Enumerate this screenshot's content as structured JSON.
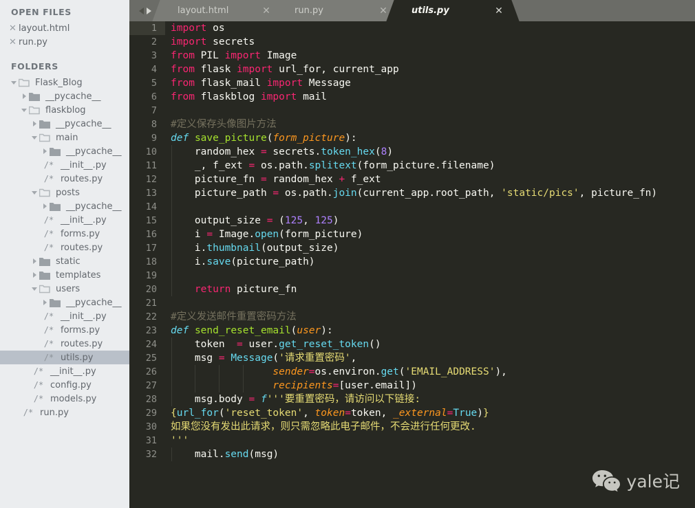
{
  "sidebar": {
    "open_files_header": "OPEN FILES",
    "open_files": [
      {
        "close_icon": "close-icon",
        "name": "layout.html"
      },
      {
        "close_icon": "close-icon",
        "name": "run.py"
      }
    ],
    "folders_header": "FOLDERS",
    "tree": [
      {
        "depth": 0,
        "type": "folder",
        "state": "open",
        "name": "Flask_Blog",
        "selected": false
      },
      {
        "depth": 1,
        "type": "folder",
        "state": "closed",
        "name": "__pycache__",
        "selected": false
      },
      {
        "depth": 1,
        "type": "folder",
        "state": "open",
        "name": "flaskblog",
        "selected": false
      },
      {
        "depth": 2,
        "type": "folder",
        "state": "closed",
        "name": "__pycache__",
        "selected": false
      },
      {
        "depth": 2,
        "type": "folder",
        "state": "open",
        "name": "main",
        "selected": false
      },
      {
        "depth": 3,
        "type": "folder",
        "state": "closed",
        "name": "__pycache__",
        "selected": false
      },
      {
        "depth": 3,
        "type": "file",
        "marker": "/*",
        "name": "__init__.py",
        "selected": false
      },
      {
        "depth": 3,
        "type": "file",
        "marker": "/*",
        "name": "routes.py",
        "selected": false
      },
      {
        "depth": 2,
        "type": "folder",
        "state": "open",
        "name": "posts",
        "selected": false
      },
      {
        "depth": 3,
        "type": "folder",
        "state": "closed",
        "name": "__pycache__",
        "selected": false
      },
      {
        "depth": 3,
        "type": "file",
        "marker": "/*",
        "name": "__init__.py",
        "selected": false
      },
      {
        "depth": 3,
        "type": "file",
        "marker": "/*",
        "name": "forms.py",
        "selected": false
      },
      {
        "depth": 3,
        "type": "file",
        "marker": "/*",
        "name": "routes.py",
        "selected": false
      },
      {
        "depth": 2,
        "type": "folder",
        "state": "closed",
        "name": "static",
        "selected": false
      },
      {
        "depth": 2,
        "type": "folder",
        "state": "closed",
        "name": "templates",
        "selected": false
      },
      {
        "depth": 2,
        "type": "folder",
        "state": "open",
        "name": "users",
        "selected": false
      },
      {
        "depth": 3,
        "type": "folder",
        "state": "closed",
        "name": "__pycache__",
        "selected": false
      },
      {
        "depth": 3,
        "type": "file",
        "marker": "/*",
        "name": "__init__.py",
        "selected": false
      },
      {
        "depth": 3,
        "type": "file",
        "marker": "/*",
        "name": "forms.py",
        "selected": false
      },
      {
        "depth": 3,
        "type": "file",
        "marker": "/*",
        "name": "routes.py",
        "selected": false
      },
      {
        "depth": 3,
        "type": "file",
        "marker": "/*",
        "name": "utils.py",
        "selected": true
      },
      {
        "depth": 2,
        "type": "file",
        "marker": "/*",
        "name": "__init__.py",
        "selected": false
      },
      {
        "depth": 2,
        "type": "file",
        "marker": "/*",
        "name": "config.py",
        "selected": false
      },
      {
        "depth": 2,
        "type": "file",
        "marker": "/*",
        "name": "models.py",
        "selected": false
      },
      {
        "depth": 1,
        "type": "file",
        "marker": "/*",
        "name": "run.py",
        "selected": false
      }
    ]
  },
  "tabbar": {
    "nav_prev_icon": "arrow-left-icon",
    "nav_next_icon": "arrow-right-icon",
    "close_glyph": "✕",
    "tabs": [
      {
        "label": "layout.html",
        "active": false
      },
      {
        "label": "run.py",
        "active": false
      },
      {
        "label": "utils.py",
        "active": true
      }
    ]
  },
  "editor": {
    "active_line": 1,
    "total_lines": 32,
    "filename": "utils.py",
    "lines": [
      {
        "n": 1,
        "tokens": [
          {
            "t": "import",
            "c": "kw"
          },
          {
            "t": " os",
            "c": "pl"
          }
        ]
      },
      {
        "n": 2,
        "tokens": [
          {
            "t": "import",
            "c": "kw"
          },
          {
            "t": " secrets",
            "c": "pl"
          }
        ]
      },
      {
        "n": 3,
        "tokens": [
          {
            "t": "from",
            "c": "kw"
          },
          {
            "t": " PIL ",
            "c": "pl"
          },
          {
            "t": "import",
            "c": "kw"
          },
          {
            "t": " Image",
            "c": "pl"
          }
        ]
      },
      {
        "n": 4,
        "tokens": [
          {
            "t": "from",
            "c": "kw"
          },
          {
            "t": " flask ",
            "c": "pl"
          },
          {
            "t": "import",
            "c": "kw"
          },
          {
            "t": " url_for, current_app",
            "c": "pl"
          }
        ]
      },
      {
        "n": 5,
        "tokens": [
          {
            "t": "from",
            "c": "kw"
          },
          {
            "t": " flask_mail ",
            "c": "pl"
          },
          {
            "t": "import",
            "c": "kw"
          },
          {
            "t": " Message",
            "c": "pl"
          }
        ]
      },
      {
        "n": 6,
        "tokens": [
          {
            "t": "from",
            "c": "kw"
          },
          {
            "t": " flaskblog ",
            "c": "pl"
          },
          {
            "t": "import",
            "c": "kw"
          },
          {
            "t": " mail",
            "c": "pl"
          }
        ]
      },
      {
        "n": 7,
        "tokens": []
      },
      {
        "n": 8,
        "tokens": [
          {
            "t": "#定义保存头像图片方法",
            "c": "cm"
          }
        ]
      },
      {
        "n": 9,
        "tokens": [
          {
            "t": "def",
            "c": "kw2"
          },
          {
            "t": " ",
            "c": "pl"
          },
          {
            "t": "save_picture",
            "c": "fn"
          },
          {
            "t": "(",
            "c": "pl"
          },
          {
            "t": "form_picture",
            "c": "param"
          },
          {
            "t": "):",
            "c": "pl"
          }
        ]
      },
      {
        "n": 10,
        "tokens": [
          {
            "t": "    random_hex ",
            "c": "pl"
          },
          {
            "t": "=",
            "c": "op"
          },
          {
            "t": " secrets.",
            "c": "pl"
          },
          {
            "t": "token_hex",
            "c": "mth"
          },
          {
            "t": "(",
            "c": "pl"
          },
          {
            "t": "8",
            "c": "num"
          },
          {
            "t": ")",
            "c": "pl"
          }
        ],
        "guides": [
          1
        ]
      },
      {
        "n": 11,
        "tokens": [
          {
            "t": "    _, f_ext ",
            "c": "pl"
          },
          {
            "t": "=",
            "c": "op"
          },
          {
            "t": " os.path.",
            "c": "pl"
          },
          {
            "t": "splitext",
            "c": "mth"
          },
          {
            "t": "(form_picture.filename)",
            "c": "pl"
          }
        ],
        "guides": [
          1
        ]
      },
      {
        "n": 12,
        "tokens": [
          {
            "t": "    picture_fn ",
            "c": "pl"
          },
          {
            "t": "=",
            "c": "op"
          },
          {
            "t": " random_hex ",
            "c": "pl"
          },
          {
            "t": "+",
            "c": "op"
          },
          {
            "t": " f_ext",
            "c": "pl"
          }
        ],
        "guides": [
          1
        ]
      },
      {
        "n": 13,
        "tokens": [
          {
            "t": "    picture_path ",
            "c": "pl"
          },
          {
            "t": "=",
            "c": "op"
          },
          {
            "t": " os.path.",
            "c": "pl"
          },
          {
            "t": "join",
            "c": "mth"
          },
          {
            "t": "(current_app.root_path, ",
            "c": "pl"
          },
          {
            "t": "'static/pics'",
            "c": "str"
          },
          {
            "t": ", picture_fn)",
            "c": "pl"
          }
        ],
        "guides": [
          1
        ]
      },
      {
        "n": 14,
        "tokens": [],
        "guides": [
          1
        ]
      },
      {
        "n": 15,
        "tokens": [
          {
            "t": "    output_size ",
            "c": "pl"
          },
          {
            "t": "=",
            "c": "op"
          },
          {
            "t": " (",
            "c": "pl"
          },
          {
            "t": "125",
            "c": "num"
          },
          {
            "t": ", ",
            "c": "pl"
          },
          {
            "t": "125",
            "c": "num"
          },
          {
            "t": ")",
            "c": "pl"
          }
        ],
        "guides": [
          1
        ]
      },
      {
        "n": 16,
        "tokens": [
          {
            "t": "    i ",
            "c": "pl"
          },
          {
            "t": "=",
            "c": "op"
          },
          {
            "t": " Image.",
            "c": "pl"
          },
          {
            "t": "open",
            "c": "mth"
          },
          {
            "t": "(form_picture)",
            "c": "pl"
          }
        ],
        "guides": [
          1
        ]
      },
      {
        "n": 17,
        "tokens": [
          {
            "t": "    i.",
            "c": "pl"
          },
          {
            "t": "thumbnail",
            "c": "mth"
          },
          {
            "t": "(output_size)",
            "c": "pl"
          }
        ],
        "guides": [
          1
        ]
      },
      {
        "n": 18,
        "tokens": [
          {
            "t": "    i.",
            "c": "pl"
          },
          {
            "t": "save",
            "c": "mth"
          },
          {
            "t": "(picture_path)",
            "c": "pl"
          }
        ],
        "guides": [
          1
        ]
      },
      {
        "n": 19,
        "tokens": [],
        "guides": [
          1
        ]
      },
      {
        "n": 20,
        "tokens": [
          {
            "t": "    ",
            "c": "pl"
          },
          {
            "t": "return",
            "c": "kw"
          },
          {
            "t": " picture_fn",
            "c": "pl"
          }
        ],
        "guides": [
          1
        ]
      },
      {
        "n": 21,
        "tokens": []
      },
      {
        "n": 22,
        "tokens": [
          {
            "t": "#定义发送邮件重置密码方法",
            "c": "cm"
          }
        ]
      },
      {
        "n": 23,
        "tokens": [
          {
            "t": "def",
            "c": "kw2"
          },
          {
            "t": " ",
            "c": "pl"
          },
          {
            "t": "send_reset_email",
            "c": "fn"
          },
          {
            "t": "(",
            "c": "pl"
          },
          {
            "t": "user",
            "c": "param"
          },
          {
            "t": "):",
            "c": "pl"
          }
        ]
      },
      {
        "n": 24,
        "tokens": [
          {
            "t": "    token  ",
            "c": "pl"
          },
          {
            "t": "=",
            "c": "op"
          },
          {
            "t": " user.",
            "c": "pl"
          },
          {
            "t": "get_reset_token",
            "c": "mth"
          },
          {
            "t": "()",
            "c": "pl"
          }
        ],
        "guides": [
          1
        ]
      },
      {
        "n": 25,
        "tokens": [
          {
            "t": "    msg ",
            "c": "pl"
          },
          {
            "t": "=",
            "c": "op"
          },
          {
            "t": " ",
            "c": "pl"
          },
          {
            "t": "Message",
            "c": "cls"
          },
          {
            "t": "(",
            "c": "pl"
          },
          {
            "t": "'请求重置密码'",
            "c": "str"
          },
          {
            "t": ",",
            "c": "pl"
          }
        ],
        "guides": [
          1
        ]
      },
      {
        "n": 26,
        "tokens": [
          {
            "t": "                 ",
            "c": "pl"
          },
          {
            "t": "sender",
            "c": "param"
          },
          {
            "t": "=",
            "c": "op"
          },
          {
            "t": "os.environ.",
            "c": "pl"
          },
          {
            "t": "get",
            "c": "mth"
          },
          {
            "t": "(",
            "c": "pl"
          },
          {
            "t": "'EMAIL_ADDRESS'",
            "c": "str"
          },
          {
            "t": "),",
            "c": "pl"
          }
        ],
        "guides": [
          1,
          2,
          3,
          4
        ]
      },
      {
        "n": 27,
        "tokens": [
          {
            "t": "                 ",
            "c": "pl"
          },
          {
            "t": "recipients",
            "c": "param"
          },
          {
            "t": "=",
            "c": "op"
          },
          {
            "t": "[user.email])",
            "c": "pl"
          }
        ],
        "guides": [
          1,
          2,
          3,
          4
        ]
      },
      {
        "n": 28,
        "tokens": [
          {
            "t": "    msg.body ",
            "c": "pl"
          },
          {
            "t": "=",
            "c": "op"
          },
          {
            "t": " ",
            "c": "pl"
          },
          {
            "t": "f",
            "c": "kw2"
          },
          {
            "t": "'''要重置密码，请访问以下链接:",
            "c": "str"
          }
        ],
        "guides": [
          1
        ]
      },
      {
        "n": 29,
        "tokens": [
          {
            "t": "{",
            "c": "str"
          },
          {
            "t": "url_for",
            "c": "mth"
          },
          {
            "t": "(",
            "c": "pl"
          },
          {
            "t": "'reset_token'",
            "c": "str"
          },
          {
            "t": ", ",
            "c": "pl"
          },
          {
            "t": "token",
            "c": "param"
          },
          {
            "t": "=",
            "c": "op"
          },
          {
            "t": "token, ",
            "c": "pl"
          },
          {
            "t": "_external",
            "c": "param"
          },
          {
            "t": "=",
            "c": "op"
          },
          {
            "t": "True",
            "c": "cls"
          },
          {
            "t": ")",
            "c": "pl"
          },
          {
            "t": "}",
            "c": "str"
          }
        ]
      },
      {
        "n": 30,
        "tokens": [
          {
            "t": "如果您没有发出此请求，则只需忽略此电子邮件，不会进行任何更改.",
            "c": "str"
          }
        ]
      },
      {
        "n": 31,
        "tokens": [
          {
            "t": "'''",
            "c": "str"
          }
        ]
      },
      {
        "n": 32,
        "tokens": [
          {
            "t": "    mail.",
            "c": "pl"
          },
          {
            "t": "send",
            "c": "mth"
          },
          {
            "t": "(msg)",
            "c": "pl"
          }
        ],
        "guides": [
          1
        ]
      }
    ]
  },
  "watermark": {
    "icon": "wechat-icon",
    "text": "yale记"
  },
  "colors": {
    "sidebar_bg": "#ebedef",
    "sidebar_selected": "#b9c0c9",
    "tabbar_bg": "#6b6c67",
    "tab_inactive_bg": "#7b7c77",
    "editor_bg": "#272822",
    "gutter_text": "#8f908a",
    "keyword": "#f92672",
    "string": "#e6db74",
    "comment": "#75715e",
    "function": "#a6e22e",
    "param": "#fd971f",
    "number": "#ae81ff",
    "type": "#66d9ef",
    "text": "#f8f8f2"
  }
}
